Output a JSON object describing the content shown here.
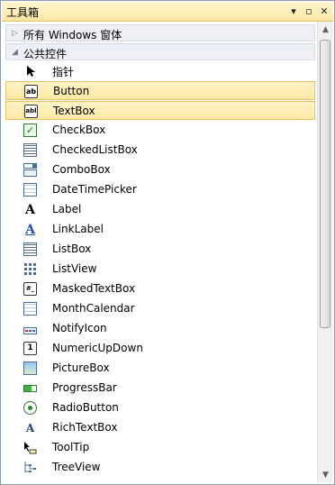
{
  "window": {
    "title": "工具箱",
    "controls": {
      "dropdown": "▾",
      "pin": "▫",
      "close": "✕"
    }
  },
  "categories": [
    {
      "label": "所有 Windows 窗体",
      "expanded": false
    },
    {
      "label": "公共控件",
      "expanded": true
    }
  ],
  "items": [
    {
      "label": "指针",
      "icon": "pointer-icon",
      "selected": false
    },
    {
      "label": "Button",
      "icon": "button-icon",
      "glyph": "ab",
      "selected": true
    },
    {
      "label": "TextBox",
      "icon": "textbox-icon",
      "glyph": "abl",
      "selected": true
    },
    {
      "label": "CheckBox",
      "icon": "checkbox-icon",
      "glyph": "✓",
      "selected": false
    },
    {
      "label": "CheckedListBox",
      "icon": "checkedlistbox-icon",
      "selected": false
    },
    {
      "label": "ComboBox",
      "icon": "combobox-icon",
      "selected": false
    },
    {
      "label": "DateTimePicker",
      "icon": "datetimepicker-icon",
      "selected": false
    },
    {
      "label": "Label",
      "icon": "label-icon",
      "glyph": "A",
      "selected": false
    },
    {
      "label": "LinkLabel",
      "icon": "linklabel-icon",
      "glyph": "A",
      "selected": false
    },
    {
      "label": "ListBox",
      "icon": "listbox-icon",
      "selected": false
    },
    {
      "label": "ListView",
      "icon": "listview-icon",
      "selected": false
    },
    {
      "label": "MaskedTextBox",
      "icon": "maskedtextbox-icon",
      "glyph": "#_",
      "selected": false
    },
    {
      "label": "MonthCalendar",
      "icon": "monthcalendar-icon",
      "selected": false
    },
    {
      "label": "NotifyIcon",
      "icon": "notifyicon-icon",
      "selected": false
    },
    {
      "label": "NumericUpDown",
      "icon": "numericupdown-icon",
      "glyph": "1",
      "selected": false
    },
    {
      "label": "PictureBox",
      "icon": "picturebox-icon",
      "selected": false
    },
    {
      "label": "ProgressBar",
      "icon": "progressbar-icon",
      "selected": false
    },
    {
      "label": "RadioButton",
      "icon": "radiobutton-icon",
      "selected": false
    },
    {
      "label": "RichTextBox",
      "icon": "richtextbox-icon",
      "glyph": "A",
      "selected": false
    },
    {
      "label": "ToolTip",
      "icon": "tooltip-icon",
      "selected": false
    },
    {
      "label": "TreeView",
      "icon": "treeview-icon",
      "selected": false
    }
  ],
  "colors": {
    "title_bar": "#ffe8a6",
    "selection": "#ffe8a3",
    "selection_border": "#e5c365",
    "category_bg": "#eef0f6",
    "panel_border": "#8e9bb4"
  }
}
